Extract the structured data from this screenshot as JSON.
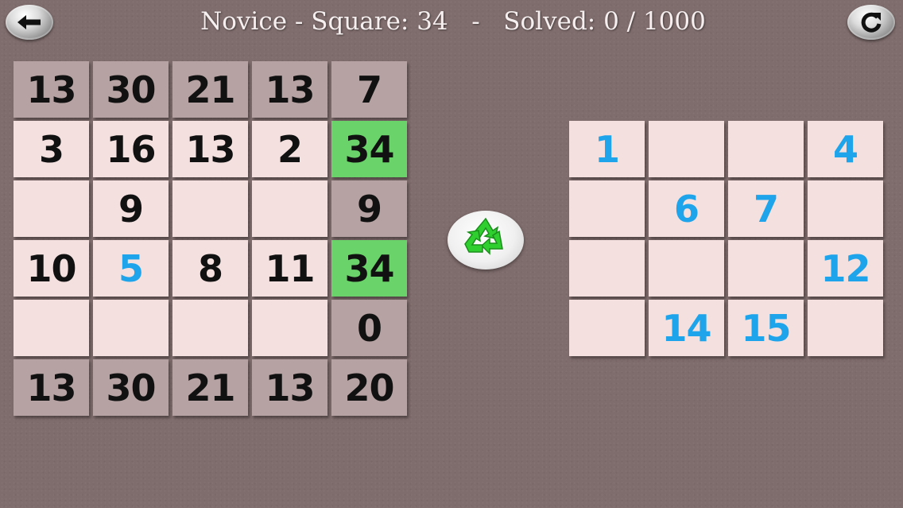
{
  "header": {
    "title": "Novice - Square: 34   -   Solved: 0 / 1000",
    "back_icon": "arrow-left-icon",
    "restart_icon": "refresh-icon"
  },
  "board": {
    "top_sums": [
      "13",
      "30",
      "21",
      "13",
      "7"
    ],
    "rows": [
      {
        "cells": [
          {
            "v": "3"
          },
          {
            "v": "16"
          },
          {
            "v": "13"
          },
          {
            "v": "2"
          }
        ],
        "sum": "34",
        "sum_complete": true
      },
      {
        "cells": [
          {
            "v": ""
          },
          {
            "v": "9"
          },
          {
            "v": ""
          },
          {
            "v": ""
          }
        ],
        "sum": "9",
        "sum_complete": false
      },
      {
        "cells": [
          {
            "v": "10"
          },
          {
            "v": "5",
            "placed": true
          },
          {
            "v": "8"
          },
          {
            "v": "11"
          }
        ],
        "sum": "34",
        "sum_complete": true
      },
      {
        "cells": [
          {
            "v": ""
          },
          {
            "v": ""
          },
          {
            "v": ""
          },
          {
            "v": ""
          }
        ],
        "sum": "0",
        "sum_complete": false
      }
    ],
    "bottom_sums": [
      "13",
      "30",
      "21",
      "13",
      "20"
    ]
  },
  "tray": {
    "tiles": [
      "1",
      "",
      "",
      "4",
      "",
      "6",
      "7",
      "",
      "",
      "",
      "",
      "12",
      "",
      "14",
      "15",
      ""
    ]
  },
  "recycle_icon": "recycle-icon",
  "colors": {
    "background": "#7f6c6c",
    "cell": "#f3e0df",
    "header_cell": "#b6a2a2",
    "complete": "#6ad36a",
    "placed_number": "#1da4ea",
    "title_text": "#f5efef"
  }
}
